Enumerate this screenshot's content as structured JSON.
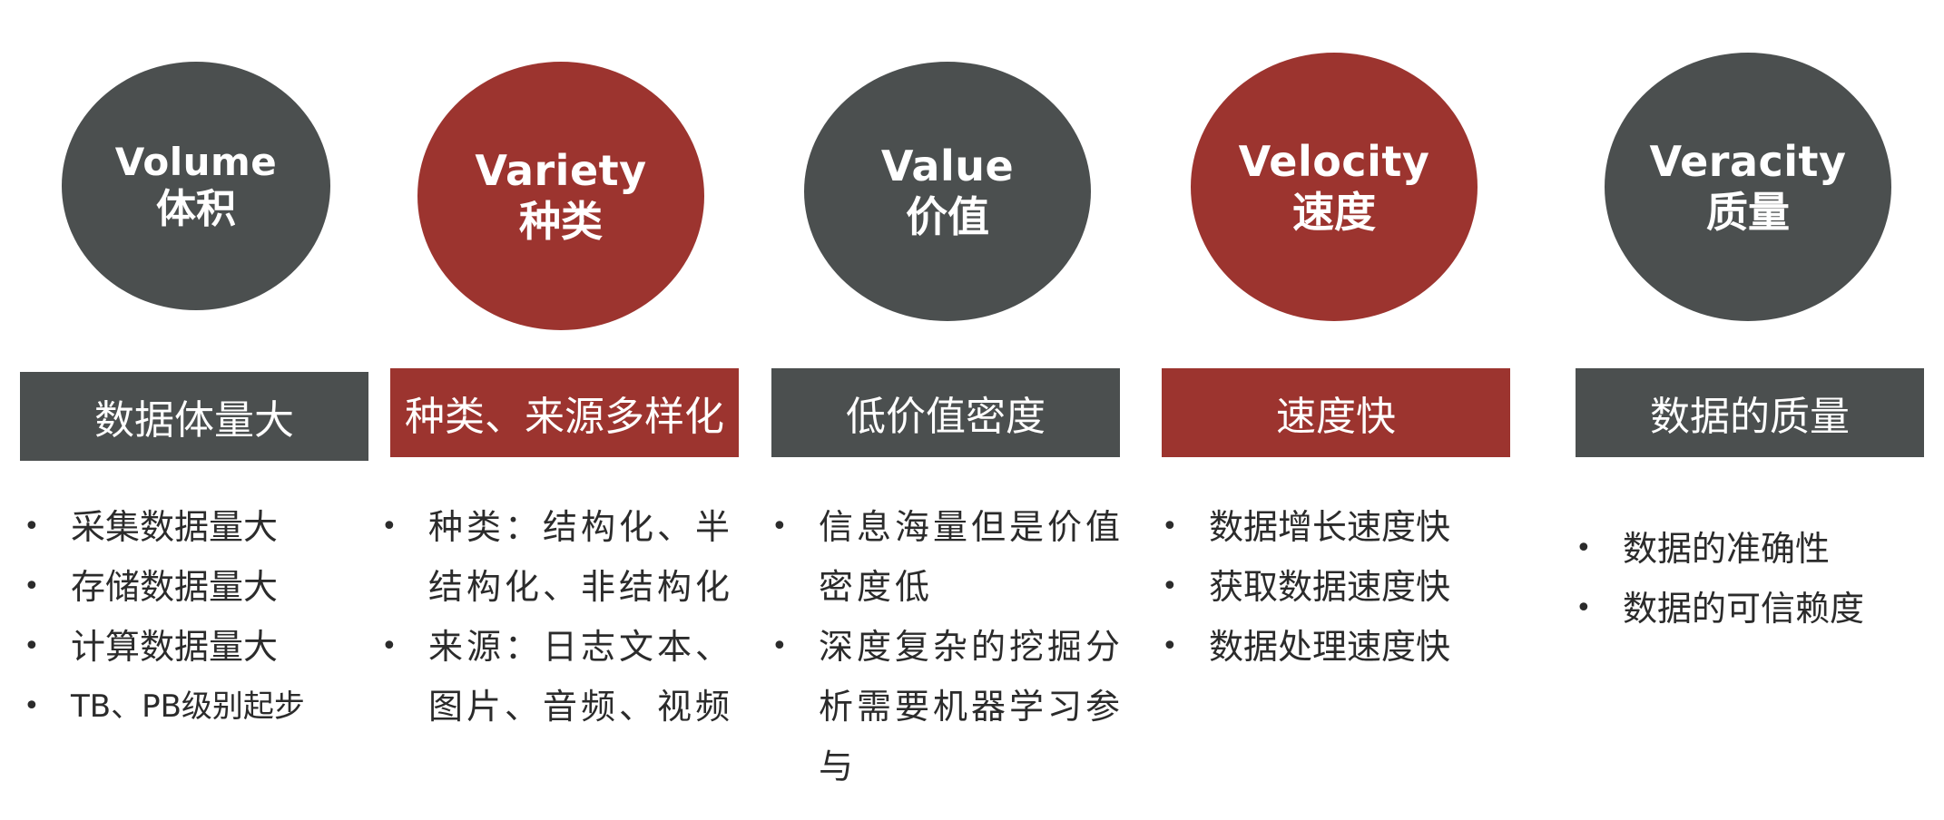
{
  "columns": [
    {
      "circle_en": "Volume",
      "circle_zh": "体积",
      "theme_color": "#4b4f4f",
      "header": "数据体量大",
      "items": [
        "采集数据量大",
        "存储数据量大",
        "计算数据量大",
        "TB、PB级别起步"
      ]
    },
    {
      "circle_en": "Variety",
      "circle_zh": "种类",
      "theme_color": "#9c342f",
      "header": "种类、来源多样化",
      "items": [
        "种类：结构化、半结构化、非结构化",
        "来源：日志文本、图片、音频、视频"
      ]
    },
    {
      "circle_en": "Value",
      "circle_zh": "价值",
      "theme_color": "#4b4f4f",
      "header": "低价值密度",
      "items": [
        "信息海量但是价值密度低",
        "深度复杂的挖掘分析需要机器学习参与"
      ]
    },
    {
      "circle_en": "Velocity",
      "circle_zh": "速度",
      "theme_color": "#9c342f",
      "header": "速度快",
      "items": [
        "数据增长速度快",
        "获取数据速度快",
        "数据处理速度快"
      ]
    },
    {
      "circle_en": "Veracity",
      "circle_zh": "质量",
      "theme_color": "#4b4f4f",
      "header": "数据的质量",
      "items": [
        "数据的准确性",
        "数据的可信赖度"
      ]
    }
  ]
}
